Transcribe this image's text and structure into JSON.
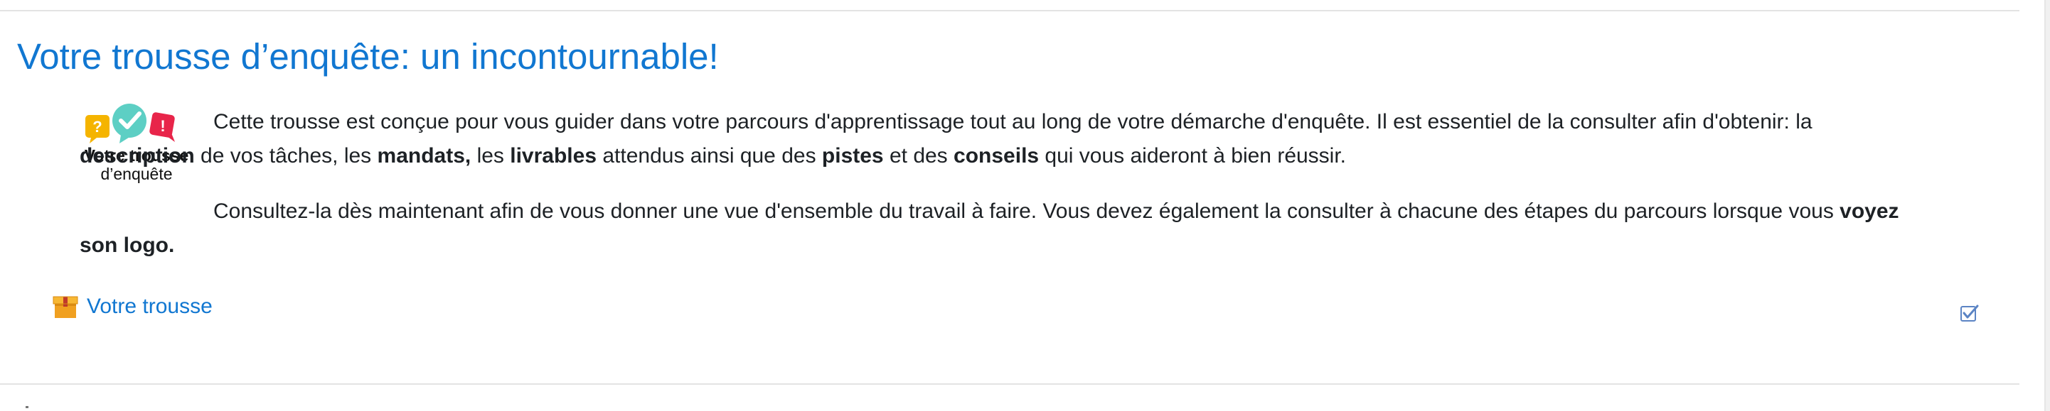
{
  "section": {
    "title": "Votre trousse d’enquête: un incontournable!"
  },
  "logo": {
    "line1": "Votre trousse",
    "line2": "d’enquête",
    "icon": "speech-bubbles-icon"
  },
  "description": {
    "p1": [
      {
        "text": "Cette trousse est conçue pour vous guider dans votre parcours d'apprentissage tout au long de votre démarche d'enquête. Il est essentiel de la consulter afin d'obtenir: la ",
        "bold": false
      },
      {
        "text": "description",
        "bold": true
      },
      {
        "text": " de vos tâches, les ",
        "bold": false
      },
      {
        "text": "mandats,",
        "bold": true
      },
      {
        "text": " les ",
        "bold": false
      },
      {
        "text": "livrables",
        "bold": true
      },
      {
        "text": " attendus ainsi que des ",
        "bold": false
      },
      {
        "text": "pistes",
        "bold": true
      },
      {
        "text": " et des ",
        "bold": false
      },
      {
        "text": "conseils",
        "bold": true
      },
      {
        "text": " qui vous aideront à bien réussir.",
        "bold": false
      }
    ],
    "p2_normal": "Consultez-la dès maintenant afin de vous donner une vue d'ensemble du travail à faire. Vous devez également la consulter à chacune des étapes du parcours lorsque vous ",
    "p2_bold": "voyez son logo."
  },
  "activity": {
    "icon": "package-icon",
    "label": "Votre trousse"
  },
  "completion": {
    "icon": "checkbox-checked-icon",
    "checked": true
  },
  "colors": {
    "link": "#1177d1",
    "text": "#1d2125",
    "bubble_yellow": "#f5b400",
    "bubble_teal": "#5dcfc4",
    "bubble_red": "#e8254a",
    "package": "#f0a020"
  }
}
